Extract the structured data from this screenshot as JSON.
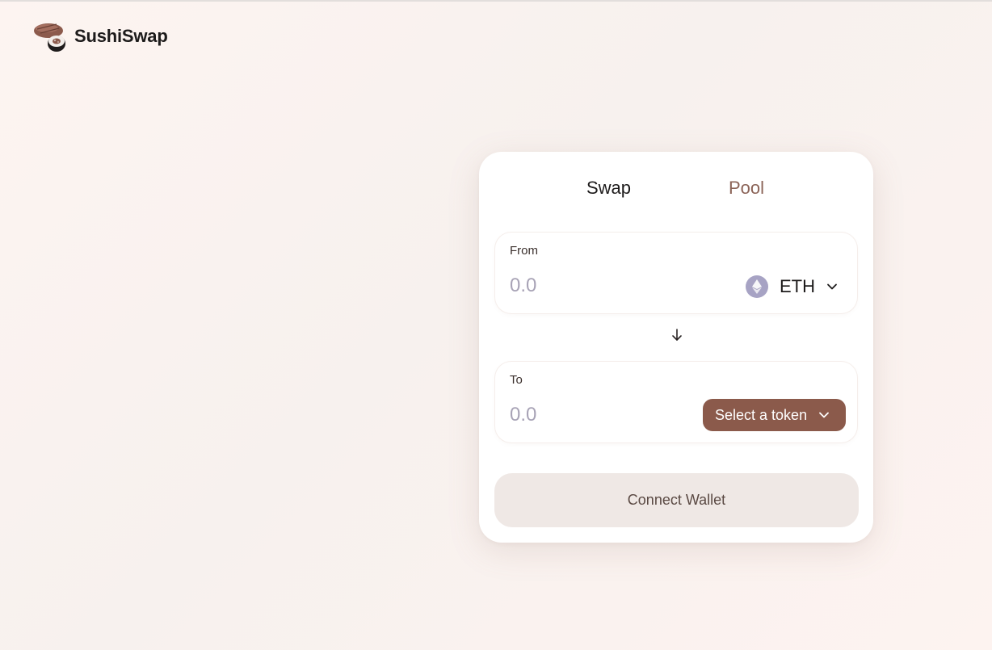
{
  "header": {
    "brand": "SushiSwap",
    "logo_icon": "sushi-logo-icon"
  },
  "tabs": [
    {
      "label": "Swap",
      "active": true
    },
    {
      "label": "Pool",
      "active": false
    }
  ],
  "from_panel": {
    "label": "From",
    "amount_placeholder": "0.0",
    "token": {
      "symbol": "ETH",
      "icon": "ethereum-icon"
    }
  },
  "switch_icon": "arrow-down-icon",
  "to_panel": {
    "label": "To",
    "amount_placeholder": "0.0",
    "select_label": "Select a token"
  },
  "connect_label": "Connect Wallet",
  "colors": {
    "accent": "#8b5a4b",
    "pool_tab": "#8b6357",
    "connect_bg": "#efe8e5",
    "eth_icon_bg": "#a7a3c4"
  }
}
